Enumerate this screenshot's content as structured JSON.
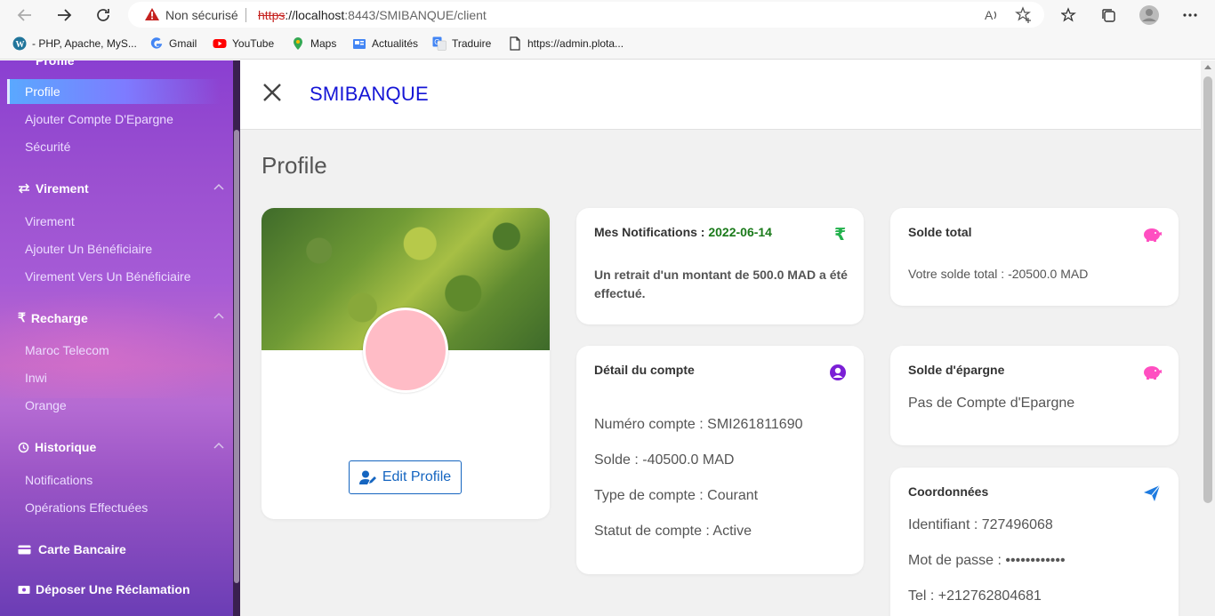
{
  "browser": {
    "security_label": "Non sécurisé",
    "url_protocol": "https",
    "url_host": "://localhost",
    "url_rest": ":8443/SMIBANQUE/client",
    "bookmarks": [
      {
        "label": "- PHP, Apache, MyS...",
        "icon": "wordpress-icon"
      },
      {
        "label": "Gmail",
        "icon": "google-icon"
      },
      {
        "label": "YouTube",
        "icon": "youtube-icon"
      },
      {
        "label": "Maps",
        "icon": "maps-icon"
      },
      {
        "label": "Actualités",
        "icon": "news-icon"
      },
      {
        "label": "Traduire",
        "icon": "translate-icon"
      },
      {
        "label": "https://admin.plota...",
        "icon": "page-icon"
      }
    ]
  },
  "sidebar": {
    "top_cut_label": "Profile",
    "profile_items": [
      "Profile",
      "Ajouter Compte D'Epargne",
      "Sécurité"
    ],
    "sections": [
      {
        "label": "Virement",
        "items": [
          "Virement",
          "Ajouter Un Bénéficiaire",
          "Virement Vers Un Bénéficiaire"
        ]
      },
      {
        "label": "Recharge",
        "items": [
          "Maroc Telecom",
          "Inwi",
          "Orange"
        ]
      },
      {
        "label": "Historique",
        "items": [
          "Notifications",
          "Opérations Effectuées"
        ]
      }
    ],
    "carte_label": "Carte Bancaire",
    "reclamation_label": "Déposer Une Réclamation"
  },
  "header": {
    "brand": "SMIBANQUE"
  },
  "page": {
    "title": "Profile"
  },
  "profile_card": {
    "edit_label": "Edit Profile"
  },
  "notifications": {
    "title": "Mes Notifications : ",
    "date": "2022-06-14",
    "message_line1": "Un retrait d'un montant de 500.0 MAD a été",
    "message_line2": "effectué."
  },
  "solde_total": {
    "title": "Solde total",
    "text": "Votre solde total : -20500.0 MAD"
  },
  "detail": {
    "title": "Détail du compte",
    "numero": "Numéro compte : SMI261811690",
    "solde": "Solde : -40500.0 MAD",
    "type": "Type de compte : Courant",
    "statut": "Statut de compte : Active"
  },
  "epargne": {
    "title": "Solde d'épargne",
    "text": "Pas de Compte d'Epargne"
  },
  "coordonnees": {
    "title": "Coordonnées",
    "identifiant": "Identifiant : 727496068",
    "password": "Mot de passe : ••••••••••••",
    "tel": "Tel : +212762804681"
  },
  "colors": {
    "brand": "#1515d6",
    "date_green": "#1a7a1a",
    "rupee_green": "#22b14c",
    "piggy_pink": "#ff4fc1",
    "user_purple": "#7b1fd6",
    "send_blue": "#1e7be0",
    "edit_blue": "#1565c0"
  }
}
